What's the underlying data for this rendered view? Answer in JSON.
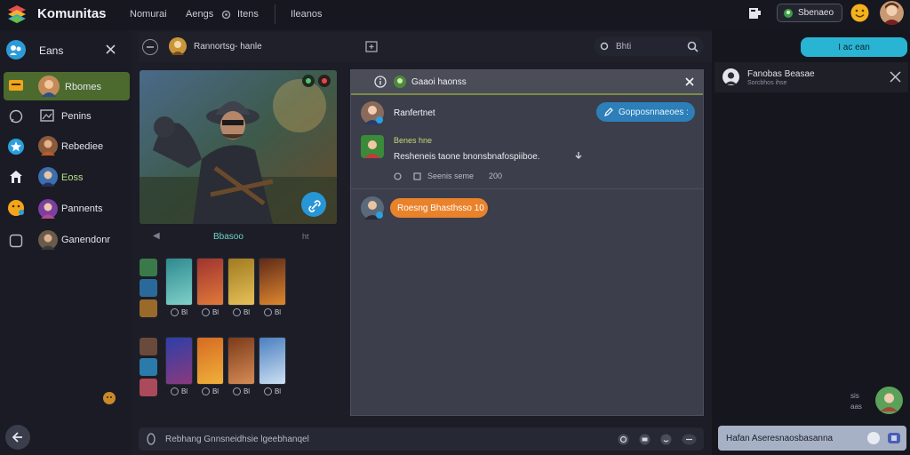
{
  "app": {
    "title": "Komunitas"
  },
  "topnav": {
    "items": [
      "Nomurai",
      "Aengs",
      "Itens",
      "Ileanos"
    ],
    "status_button": "Sbenaeo",
    "icons": [
      "logo-icon",
      "bookmark-icon",
      "smile-icon",
      "avatar"
    ]
  },
  "sidebar": {
    "header": "Eans",
    "items": [
      {
        "label": "Rbomes",
        "active": true
      },
      {
        "label": "Penins",
        "active": false
      },
      {
        "label": "Rebediee",
        "active": false
      },
      {
        "label": "Eoss",
        "active": false
      },
      {
        "label": "Pannents",
        "active": false
      },
      {
        "label": "Ganendonr",
        "active": false
      }
    ]
  },
  "toolbar": {
    "label": "Rannortsg- hanle",
    "search_placeholder": "Bhti"
  },
  "hero": {
    "caption": "Bbasoo",
    "left_marker": "◀",
    "right_marker": "ht"
  },
  "grid_rows": [
    {
      "cards": [
        {
          "badge": "Bl",
          "colors": [
            "#2e8a8f",
            "#7fd0c9"
          ]
        },
        {
          "badge": "Bl",
          "colors": [
            "#a0332f",
            "#e07a3a"
          ]
        },
        {
          "badge": "Bl",
          "colors": [
            "#a07a1e",
            "#e6c15a"
          ]
        },
        {
          "badge": "Bl",
          "colors": [
            "#5e2a18",
            "#e0872f"
          ]
        }
      ]
    },
    {
      "cards": [
        {
          "badge": "Bl",
          "colors": [
            "#2d3fa8",
            "#8a3a7d"
          ]
        },
        {
          "badge": "Bl",
          "colors": [
            "#d66a22",
            "#f0b13a"
          ]
        },
        {
          "badge": "Bl",
          "colors": [
            "#7c3a1a",
            "#d58c54"
          ]
        },
        {
          "badge": "Bl",
          "colors": [
            "#4a7fc0",
            "#cde0f2"
          ]
        }
      ]
    }
  ],
  "chat": {
    "title": "Gaaoi haonss",
    "messages": [
      {
        "name": "Ranfertnet",
        "button": "Gopposnnaeoes :"
      },
      {
        "name": "Benes hne",
        "text": "Resheneis taone bnonsbnafospiiboe.",
        "meta_left": "Seenis seme",
        "meta_right": "200"
      },
      {
        "name": "",
        "button": "Roesng Bhasthsso 10"
      }
    ]
  },
  "composer": {
    "placeholder": "Rebhang Gnnsneidhsie lgeebhanqel"
  },
  "right_panel": {
    "button": "I ac ean",
    "card_title": "Fanobas Beasae",
    "card_sub": "Sorcbhos ihse",
    "bottom_input": "Hafan Aseresnaosbasanna",
    "side_lines": [
      "sis",
      "aas"
    ]
  }
}
